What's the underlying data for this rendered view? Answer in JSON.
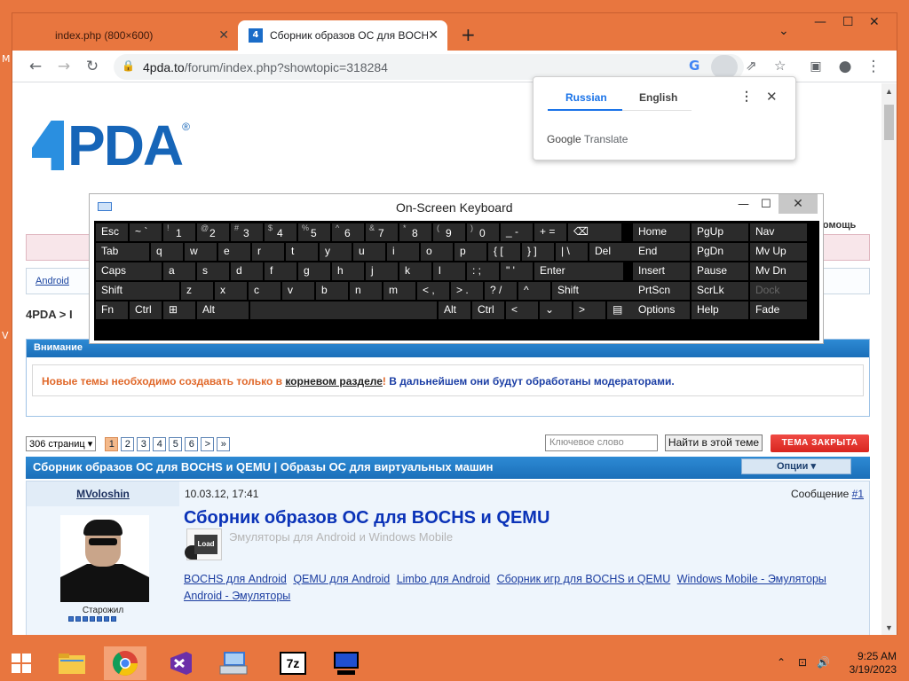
{
  "desktop": {
    "frag_top": "M",
    "frag_mid": "V"
  },
  "tabs": [
    {
      "title": "index.php (800×600)",
      "close": "✕"
    },
    {
      "title": "Сборник образов ОС для BOCHS",
      "close": "✕",
      "favicon": "4"
    }
  ],
  "new_tab": "+",
  "window_controls": {
    "dropdown": "⌄",
    "minimize": "—",
    "maximize": "☐",
    "close": "✕"
  },
  "toolbar": {
    "back": "←",
    "forward": "→",
    "reload": "↻",
    "url_host": "4pda.to",
    "url_path": "/forum/index.php?showtopic=318284",
    "lock": "🔒"
  },
  "omni_icons": {
    "google": "G",
    "share": "⇗",
    "star": "☆"
  },
  "right_icons": {
    "sidepanel": "▣",
    "profile": "●",
    "menu": "⋮"
  },
  "translate_popup": {
    "lang_from": "Russian",
    "lang_to": "English",
    "menu": "⋮",
    "close": "✕",
    "brand_google": "Google",
    "brand_translate": "Translate"
  },
  "site": {
    "logo": "PDA",
    "logo_4": "4",
    "reg": "®",
    "help": "Помощь",
    "android_link": "Android",
    "breadcrumb": "4PDA > I",
    "attention": {
      "title": "Внимание",
      "text1": "Новые темы необходимо создавать только в ",
      "link": "корневом разделе",
      "text2": "! ",
      "text3": "В дальнейшем они будут обработаны модераторами."
    },
    "pager": {
      "select": "306 страниц ▾",
      "pages": [
        "1",
        "2",
        "3",
        "4",
        "5",
        "6",
        ">",
        "»"
      ]
    },
    "search_placeholder": "Ключевое слово",
    "search_button": "Найти в этой теме",
    "closed_button": "ТЕМА ЗАКРЫТА",
    "topic_title": "Сборник образов ОС для BOCHS и QEMU | Образы ОС для виртуальных машин",
    "options_button": "Опции ▾",
    "post": {
      "author": "MVoloshin",
      "rank": "Старожил",
      "date": "10.03.12, 17:41",
      "msg_label": "Сообщение ",
      "msg_num": "#1",
      "title": "Сборник образов ОС для BOCHS и QEMU",
      "subtitle": "Эмуляторы для Android и Windows Mobile",
      "load_label": "Load",
      "links": [
        "BOCHS для Android",
        "QEMU для Android",
        "Limbo для Android",
        "Сборник игр для BOCHS и QEMU",
        "Windows Mobile - Эмуляторы",
        "Android - Эмуляторы"
      ]
    }
  },
  "osk": {
    "title": "On-Screen Keyboard",
    "min": "—",
    "max": "☐",
    "close": "✕",
    "rows": [
      [
        {
          "l": "Esc"
        },
        {
          "l": "~ `"
        },
        {
          "s": "!",
          "l": "1"
        },
        {
          "s": "@",
          "l": "2"
        },
        {
          "s": "#",
          "l": "3"
        },
        {
          "s": "$",
          "l": "4"
        },
        {
          "s": "%",
          "l": "5"
        },
        {
          "s": "^",
          "l": "6"
        },
        {
          "s": "&",
          "l": "7"
        },
        {
          "s": "*",
          "l": "8"
        },
        {
          "s": "(",
          "l": "9"
        },
        {
          "s": ")",
          "l": "0"
        },
        {
          "l": "_ -"
        },
        {
          "l": "+ ="
        },
        {
          "l": "⌫"
        },
        {
          "l": "Home"
        },
        {
          "l": "PgUp"
        },
        {
          "l": "Nav"
        }
      ],
      [
        {
          "l": "Tab"
        },
        {
          "l": "q"
        },
        {
          "l": "w"
        },
        {
          "l": "e"
        },
        {
          "l": "r"
        },
        {
          "l": "t"
        },
        {
          "l": "y"
        },
        {
          "l": "u"
        },
        {
          "l": "i"
        },
        {
          "l": "o"
        },
        {
          "l": "p"
        },
        {
          "l": "{ ["
        },
        {
          "l": "} ]"
        },
        {
          "l": "| \\"
        },
        {
          "l": "Del"
        },
        {
          "l": "End"
        },
        {
          "l": "PgDn"
        },
        {
          "l": "Mv Up"
        }
      ],
      [
        {
          "l": "Caps"
        },
        {
          "l": "a"
        },
        {
          "l": "s"
        },
        {
          "l": "d"
        },
        {
          "l": "f"
        },
        {
          "l": "g"
        },
        {
          "l": "h"
        },
        {
          "l": "j"
        },
        {
          "l": "k"
        },
        {
          "l": "l"
        },
        {
          "l": ": ;"
        },
        {
          "l": "\" '"
        },
        {
          "l": "Enter"
        },
        {
          "l": "Insert"
        },
        {
          "l": "Pause"
        },
        {
          "l": "Mv Dn"
        }
      ],
      [
        {
          "l": "Shift"
        },
        {
          "l": "z"
        },
        {
          "l": "x"
        },
        {
          "l": "c"
        },
        {
          "l": "v"
        },
        {
          "l": "b"
        },
        {
          "l": "n"
        },
        {
          "l": "m"
        },
        {
          "l": "< ,"
        },
        {
          "l": "> ."
        },
        {
          "l": "? /"
        },
        {
          "l": "^"
        },
        {
          "l": "Shift"
        },
        {
          "l": "PrtScn"
        },
        {
          "l": "ScrLk"
        },
        {
          "l": "Dock"
        }
      ],
      [
        {
          "l": "Fn"
        },
        {
          "l": "Ctrl"
        },
        {
          "l": "⊞"
        },
        {
          "l": "Alt"
        },
        {
          "l": ""
        },
        {
          "l": "Alt"
        },
        {
          "l": "Ctrl"
        },
        {
          "l": "<"
        },
        {
          "l": "⌄"
        },
        {
          "l": ">"
        },
        {
          "l": "▤"
        },
        {
          "l": "Options"
        },
        {
          "l": "Help"
        },
        {
          "l": "Fade"
        }
      ]
    ]
  },
  "taskbar": {
    "start": "⊞",
    "clock_time": "9:25 AM",
    "clock_date": "3/19/2023",
    "tray_up": "⌃",
    "tray_net": "⊡",
    "tray_vol": "🔊",
    "seven_zip": "7z"
  }
}
